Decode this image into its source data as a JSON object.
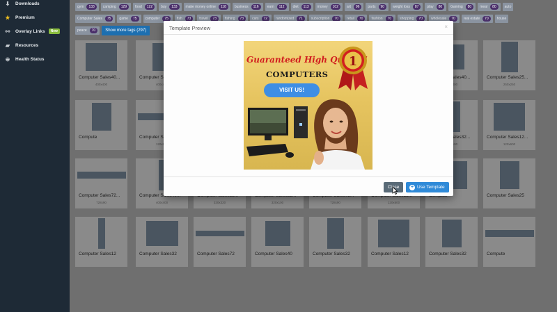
{
  "sidebar": {
    "items": [
      {
        "label": "Downloads",
        "icon": "download-icon"
      },
      {
        "label": "Premium",
        "icon": "star-icon"
      },
      {
        "label": "Overlay Links",
        "icon": "link-icon",
        "badge": "New"
      },
      {
        "label": "Resources",
        "icon": "folder-icon"
      },
      {
        "label": "Health Status",
        "icon": "globe-icon"
      }
    ]
  },
  "tags": {
    "row1": [
      {
        "label": "gym",
        "count": "133"
      },
      {
        "label": "camping",
        "count": "129"
      },
      {
        "label": "food",
        "count": "122"
      },
      {
        "label": "buy",
        "count": "133"
      },
      {
        "label": "make money online",
        "count": "118"
      },
      {
        "label": "business",
        "count": "116"
      },
      {
        "label": "earn",
        "count": "112"
      },
      {
        "label": "diet",
        "count": "113"
      },
      {
        "label": "money",
        "count": "102"
      },
      {
        "label": "art",
        "count": "96"
      },
      {
        "label": "parts",
        "count": "90"
      },
      {
        "label": "weight loss",
        "count": "87"
      },
      {
        "label": "play",
        "count": "80"
      },
      {
        "label": "Gaming",
        "count": "80"
      },
      {
        "label": "meal",
        "count": "80"
      },
      {
        "label": "auto",
        "count": ""
      }
    ],
    "row2": [
      {
        "label": "Computer Sales",
        "count": "75"
      },
      {
        "label": "game",
        "count": "75"
      },
      {
        "label": "computer",
        "count": "75"
      },
      {
        "label": "fish",
        "count": "73"
      },
      {
        "label": "travel",
        "count": "73"
      },
      {
        "label": "fishing",
        "count": "73"
      },
      {
        "label": "cars",
        "count": "72"
      },
      {
        "label": "randomized",
        "count": "71"
      },
      {
        "label": "subscription",
        "count": "70"
      },
      {
        "label": "retail",
        "count": "70"
      },
      {
        "label": "fashion",
        "count": "70"
      },
      {
        "label": "shopping",
        "count": "70"
      },
      {
        "label": "wholesale",
        "count": "70"
      },
      {
        "label": "real estate",
        "count": "70"
      },
      {
        "label": "house",
        "count": ""
      }
    ],
    "row3": [
      {
        "label": "peace",
        "count": "70"
      }
    ],
    "show_more": "Show more tags (297)"
  },
  "cards": [
    {
      "name": "Computer Sales40...",
      "dim": "400x400"
    },
    {
      "name": "Computer Sales40...",
      "dim": "400x400"
    },
    {
      "name": "Computer Sales25...",
      "dim": "250x250"
    },
    {
      "name": "Computer Sales12...",
      "dim": "120x600"
    },
    {
      "name": "Compute",
      "dim": ""
    },
    {
      "name": "Computer Sales72...",
      "dim": "728x90"
    },
    {
      "name": "Computer Sales40...",
      "dim": "400x400"
    },
    {
      "name": "Computer Sales25...",
      "dim": "250x250"
    },
    {
      "name": "Compute",
      "dim": ""
    },
    {
      "name": "Computer Sales12...",
      "dim": "120x600"
    },
    {
      "name": "Computer",
      "dim": "728x90"
    },
    {
      "name": "Computer Sales72...",
      "dim": "728x90"
    },
    {
      "name": "Computer Sales40...",
      "dim": "400x400"
    },
    {
      "name": "Compute",
      "dim": ""
    },
    {
      "name": "Computer Sales32...",
      "dim": "320x100"
    },
    {
      "name": "Computer Sales12...",
      "dim": "120x600"
    },
    {
      "name": "Computer Sales72...",
      "dim": "728x90"
    },
    {
      "name": "Computer Sales40...",
      "dim": "400x400"
    },
    {
      "name": "Computer Sales32...",
      "dim": "320x320"
    },
    {
      "name": "Computer Sales32...",
      "dim": "320x100"
    },
    {
      "name": "Computer Sales72...",
      "dim": "728x90"
    },
    {
      "name": "Computer Sales12...",
      "dim": "120x600"
    },
    {
      "name": "Compute",
      "dim": ""
    },
    {
      "name": "Computer Sales25",
      "dim": ""
    },
    {
      "name": "Computer Sales12",
      "dim": ""
    },
    {
      "name": "Computer Sales32",
      "dim": ""
    },
    {
      "name": "Computer Sales72",
      "dim": ""
    },
    {
      "name": "Computer Sales40",
      "dim": ""
    },
    {
      "name": "Computer Sales32",
      "dim": ""
    },
    {
      "name": "Computer Sales12",
      "dim": ""
    },
    {
      "name": "Computer Sales32",
      "dim": ""
    },
    {
      "name": "Compute",
      "dim": ""
    }
  ],
  "modal": {
    "title": "Template Preview",
    "close_x": "×",
    "close_label": "Close",
    "use_label": "Use Template",
    "preview": {
      "headline": "Guaranteed High Quality!",
      "subhead": "COMPUTERS",
      "button": "VISIT US!",
      "award_number": "1"
    }
  },
  "colors": {
    "sidebar_bg": "#1e2a36",
    "accent_blue": "#2f8ad8",
    "tag_count": "#4a2f6a",
    "headline_red": "#d11f1f"
  }
}
